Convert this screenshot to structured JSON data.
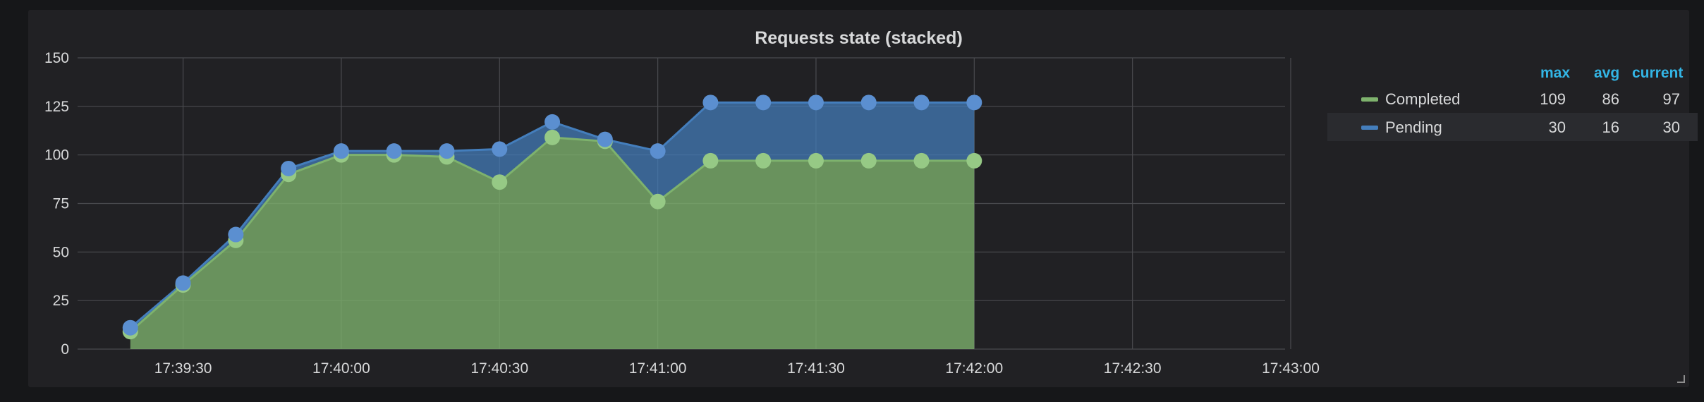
{
  "panel": {
    "title": "Requests state (stacked)"
  },
  "legend": {
    "headers": {
      "max": "max",
      "avg": "avg",
      "current": "current"
    },
    "rows": [
      {
        "name": "Completed",
        "max": "109",
        "avg": "86",
        "current": "97"
      },
      {
        "name": "Pending",
        "max": "30",
        "avg": "16",
        "current": "30"
      }
    ]
  },
  "colors": {
    "completed": "#7eb26d",
    "pending": "#447ebc",
    "panel_bg": "#212124",
    "page_bg": "#161719",
    "grid": "#4a4b4f",
    "legend_header": "#33b5e5"
  },
  "chart_data": {
    "type": "area",
    "stacked": true,
    "title": "Requests state (stacked)",
    "xlabel": "",
    "ylabel": "",
    "x_type": "time",
    "xlim": [
      "17:39:10",
      "17:43:00"
    ],
    "ylim": [
      0,
      150
    ],
    "y_ticks": [
      "0",
      "25",
      "50",
      "75",
      "100",
      "125",
      "150"
    ],
    "x_ticks": [
      "17:39:30",
      "17:40:00",
      "17:40:30",
      "17:41:00",
      "17:41:30",
      "17:42:00",
      "17:42:30",
      "17:43:00"
    ],
    "x": [
      "17:39:20",
      "17:39:30",
      "17:39:40",
      "17:39:50",
      "17:40:00",
      "17:40:10",
      "17:40:20",
      "17:40:30",
      "17:40:40",
      "17:40:50",
      "17:41:00",
      "17:41:10",
      "17:41:20",
      "17:41:30",
      "17:41:40",
      "17:41:50",
      "17:42:00"
    ],
    "series": [
      {
        "name": "Completed",
        "values": [
          9,
          33,
          56,
          90,
          100,
          100,
          99,
          86,
          109,
          107,
          76,
          97,
          97,
          97,
          97,
          97,
          97
        ]
      },
      {
        "name": "Pending",
        "values": [
          2,
          1,
          3,
          3,
          2,
          2,
          3,
          17,
          8,
          1,
          26,
          30,
          30,
          30,
          30,
          30,
          30
        ]
      }
    ],
    "grid": true,
    "legend_position": "right",
    "points": true
  }
}
